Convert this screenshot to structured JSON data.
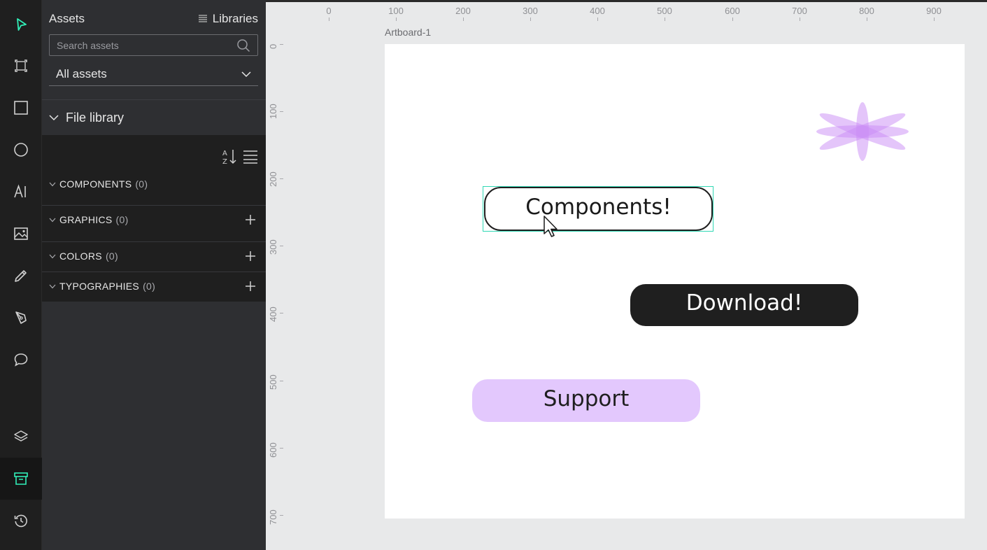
{
  "toolbar": {
    "tools": [
      {
        "name": "move-tool",
        "icon": "pointer-icon"
      },
      {
        "name": "board-tool",
        "icon": "board-icon"
      },
      {
        "name": "rectangle-tool",
        "icon": "rectangle-icon"
      },
      {
        "name": "ellipse-tool",
        "icon": "ellipse-icon"
      },
      {
        "name": "text-tool",
        "icon": "text-icon"
      },
      {
        "name": "image-tool",
        "icon": "image-icon"
      },
      {
        "name": "curve-tool",
        "icon": "pencil-icon"
      },
      {
        "name": "path-tool",
        "icon": "pen-icon"
      },
      {
        "name": "comments-tool",
        "icon": "comment-icon"
      },
      {
        "name": "layers-tool",
        "icon": "layers-icon"
      },
      {
        "name": "assets-tool",
        "icon": "archive-icon"
      },
      {
        "name": "history-tool",
        "icon": "history-icon"
      }
    ],
    "accent_color": "#31efb8"
  },
  "panel": {
    "title": "Assets",
    "libraries_label": "Libraries",
    "search_placeholder": "Search assets",
    "filter_value": "All assets",
    "file_library_label": "File library",
    "groups": [
      {
        "label": "COMPONENTS",
        "count": "(0)",
        "has_add": false
      },
      {
        "label": "GRAPHICS",
        "count": "(0)",
        "has_add": true
      },
      {
        "label": "COLORS",
        "count": "(0)",
        "has_add": true
      },
      {
        "label": "TYPOGRAPHIES",
        "count": "(0)",
        "has_add": true
      }
    ]
  },
  "canvas": {
    "h_ruler": [
      "0",
      "100",
      "200",
      "300",
      "400",
      "500",
      "600",
      "700",
      "800",
      "900"
    ],
    "v_ruler": [
      "0",
      "100",
      "200",
      "300",
      "400",
      "500",
      "600",
      "700"
    ],
    "artboard_name": "Artboard-1",
    "buttons": {
      "components": "Components!",
      "download": "Download!",
      "support": "Support"
    },
    "colors": {
      "selection": "#31d8b4",
      "support_fill": "#e3c8fd",
      "flower": "#c98cf5"
    }
  }
}
